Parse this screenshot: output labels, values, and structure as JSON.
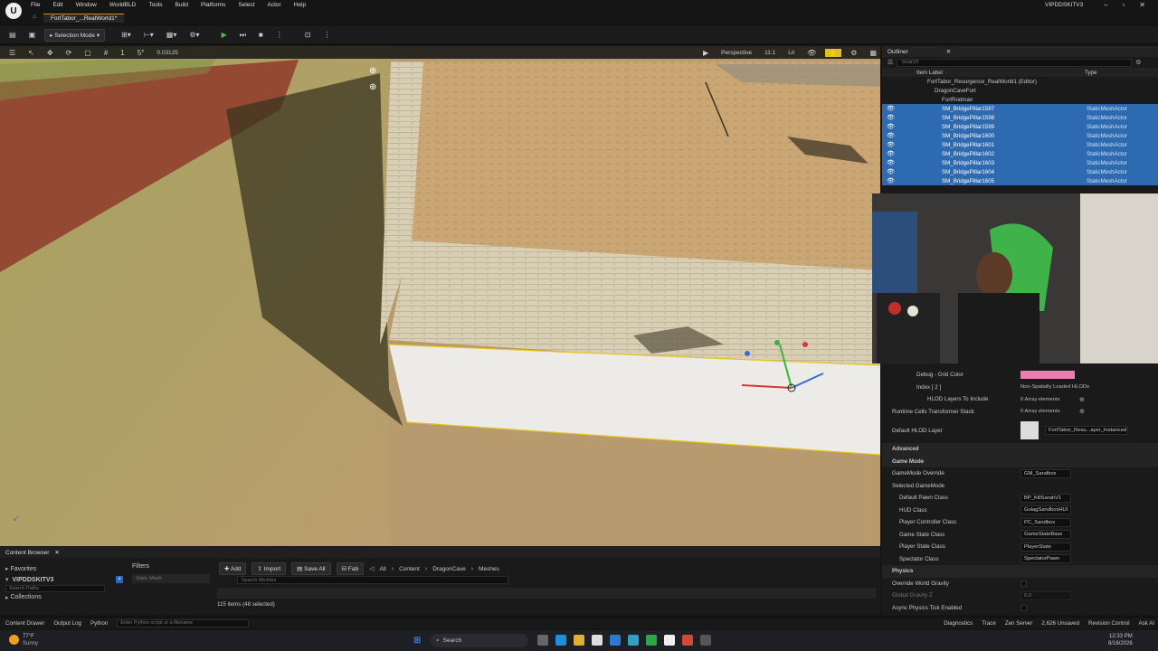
{
  "app": {
    "title": "VIPDDSKITV3",
    "tab": "FortTabor_...RealWorld1*",
    "logo": "U"
  },
  "menu": [
    "File",
    "Edit",
    "Window",
    "WorldBLD",
    "Tools",
    "Build",
    "Platforms",
    "Select",
    "Actor",
    "Help"
  ],
  "toolbar": {
    "selection_mode": "Selection Mode",
    "viewport_mode": "Perspective",
    "lit": "Lit",
    "snap_scale": "0.03125",
    "grid": "5°",
    "angle": "1",
    "fov": "11:1"
  },
  "outliner": {
    "title": "Outliner",
    "search_placeholder": "Search",
    "col_label": "Item Label",
    "col_type": "Type",
    "tree": [
      "FortTabor_Resurgence_RealWorld1 (Editor)",
      "DragonCaveFort",
      "FortRodman"
    ],
    "items": [
      {
        "name": "SM_BridgePillar1597",
        "type": "StaticMeshActor"
      },
      {
        "name": "SM_BridgePillar1598",
        "type": "StaticMeshActor"
      },
      {
        "name": "SM_BridgePillar1599",
        "type": "StaticMeshActor"
      },
      {
        "name": "SM_BridgePillar1600",
        "type": "StaticMeshActor"
      },
      {
        "name": "SM_BridgePillar1601",
        "type": "StaticMeshActor"
      },
      {
        "name": "SM_BridgePillar1602",
        "type": "StaticMeshActor"
      },
      {
        "name": "SM_BridgePillar1603",
        "type": "StaticMeshActor"
      },
      {
        "name": "SM_BridgePillar1604",
        "type": "StaticMeshActor"
      },
      {
        "name": "SM_BridgePillar1605",
        "type": "StaticMeshActor"
      }
    ]
  },
  "details": {
    "rows": [
      {
        "label": "Debug - Grid Color",
        "value": "",
        "kind": "color"
      },
      {
        "label": "Index [ 2 ]",
        "value": "Non-Spatially Loaded HLODs",
        "kind": "plain"
      },
      {
        "label": "HLOD Layers To Include",
        "value": "0 Array elements",
        "kind": "plain"
      },
      {
        "label": "Runtime Cells Transformer Stack",
        "value": "0 Array elements",
        "kind": "plain"
      },
      {
        "label": "Default HLOD Layer",
        "value": "FortTabor_Resu...ayer_Instanced",
        "kind": "asset"
      }
    ],
    "advanced": "Advanced",
    "game_mode_section": "Game Mode",
    "gamemode_override_label": "GameMode Override",
    "gamemode_override_value": "GM_Sandbox",
    "selected_gamemode": "Selected GameMode",
    "gm_rows": [
      {
        "label": "Default Pawn Class",
        "value": "BP_KillSarahV1"
      },
      {
        "label": "HUD Class",
        "value": "GulagSandboxHUI"
      },
      {
        "label": "Player Controller Class",
        "value": "PC_Sandbox"
      },
      {
        "label": "Game State Class",
        "value": "GameStateBase"
      },
      {
        "label": "Player State Class",
        "value": "PlayerState"
      },
      {
        "label": "Spectator Class",
        "value": "SpectatorPawn"
      }
    ],
    "physics_section": "Physics",
    "physics_rows": [
      {
        "label": "Override World Gravity",
        "value": ""
      },
      {
        "label": "Global Gravity Z",
        "value": "0.0"
      },
      {
        "label": "Async Physics Tick Enabled",
        "value": ""
      }
    ],
    "grid_color": "#e97fb0"
  },
  "content": {
    "title": "Content Browser",
    "favorites": "Favorites",
    "project": "VIPDDSKITV3",
    "collections": "Collections",
    "search_paths": "Search Paths",
    "filters": "Filters",
    "add": "Add",
    "import": "Import",
    "save_all": "Save All",
    "fab": "Fab",
    "breadcrumb": [
      "All",
      "Content",
      "DragonCave",
      "Meshes"
    ],
    "search_meshes": "Search Meshes",
    "static_mesh": "Static Mesh",
    "count": "115 items (48 selected)"
  },
  "statusbar": {
    "content_drawer": "Content Drawer",
    "output_log": "Output Log",
    "python": "Python",
    "python_placeholder": "Enter Python script or a filename",
    "diagnostics": "Diagnostics",
    "trace": "Trace",
    "zen": "Zen Server",
    "unsaved": "2,626 Unsaved",
    "revision": "Revision Control",
    "ask": "Ask AI"
  },
  "taskbar": {
    "temp": "77°F",
    "weather": "Sunny",
    "search": "Search",
    "time": "12:33 PM",
    "date": "8/16/2026"
  }
}
